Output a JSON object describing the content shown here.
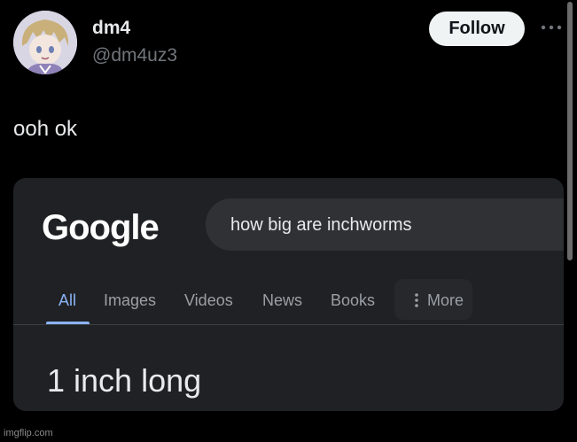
{
  "tweet": {
    "author": {
      "display_name": "dm4",
      "handle": "@dm4uz3",
      "avatar_icon": "anime-avatar-icon"
    },
    "follow_label": "Follow",
    "more_icon": "more-options-icon",
    "text": "ooh ok"
  },
  "embedded_screenshot": {
    "logo_text": "Google",
    "search_query": "how big are inchworms",
    "tabs": [
      {
        "label": "All",
        "active": true
      },
      {
        "label": "Images",
        "active": false
      },
      {
        "label": "Videos",
        "active": false
      },
      {
        "label": "News",
        "active": false
      },
      {
        "label": "Books",
        "active": false
      }
    ],
    "more_tab": {
      "label": "More",
      "icon": "kebab-icon"
    },
    "answer": "1 inch long"
  },
  "watermark": "imgflip.com",
  "colors": {
    "background": "#000000",
    "follow_button_bg": "#eff3f4",
    "card_bg": "#202124",
    "search_box_bg": "#303134",
    "active_tab": "#8ab4f8",
    "inactive_tab": "#9aa0a6",
    "handle": "#71767b"
  }
}
